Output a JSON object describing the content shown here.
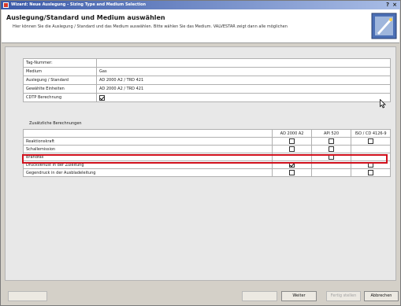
{
  "window": {
    "title": "Wizard: Neue Auslegung - Sizing Type and Medium Selection",
    "help_glyph": "?",
    "close_glyph": "×"
  },
  "header": {
    "title": "Auslegung/Standard und Medium auswählen",
    "description": "Hier können Sie die Auslegung / Standard und das Medium auswählen. Bitte wählen Sie das Medium. VALVESTAR zeigt dann alle möglichen"
  },
  "properties": [
    {
      "label": "Tag-Nummer:",
      "value": "",
      "type": "text"
    },
    {
      "label": "Medium",
      "value": "Gas",
      "type": "text"
    },
    {
      "label": "Auslegung / Standard",
      "value": "AD 2000 A2 / TRD 421",
      "type": "text"
    },
    {
      "label": "Gewählte Einheiten",
      "value": "AD 2000 A2 / TRD 421",
      "type": "text"
    },
    {
      "label": "CDTP Berechnung",
      "value": "checked",
      "type": "checkbox"
    }
  ],
  "additional": {
    "section_label": "Zusätzliche Berechnungen",
    "columns": [
      "AD 2000 A2",
      "API 520",
      "ISO / CD 4126-9"
    ],
    "rows": [
      {
        "label": "Reaktionskraft",
        "cells": [
          "empty",
          "empty",
          "empty"
        ]
      },
      {
        "label": "Schallemission",
        "cells": [
          "empty",
          "empty",
          "none"
        ],
        "highlighted": true
      },
      {
        "label": "Brandfall",
        "cells": [
          "none",
          "empty",
          "none"
        ]
      },
      {
        "label": "Druckverlust in der Zuleitung",
        "cells": [
          "checked",
          "none",
          "empty"
        ]
      },
      {
        "label": "Gegendruck in der Ausbladeleitung",
        "cells": [
          "empty",
          "none",
          "empty"
        ]
      }
    ]
  },
  "footer": {
    "left_label": "",
    "back_label": "",
    "next_label": "Weiter",
    "finish_label": "Fertig stellen",
    "cancel_label": "Abbrechen"
  },
  "colors": {
    "highlight": "#d0101c",
    "titlebar": "#3b5aa8"
  }
}
